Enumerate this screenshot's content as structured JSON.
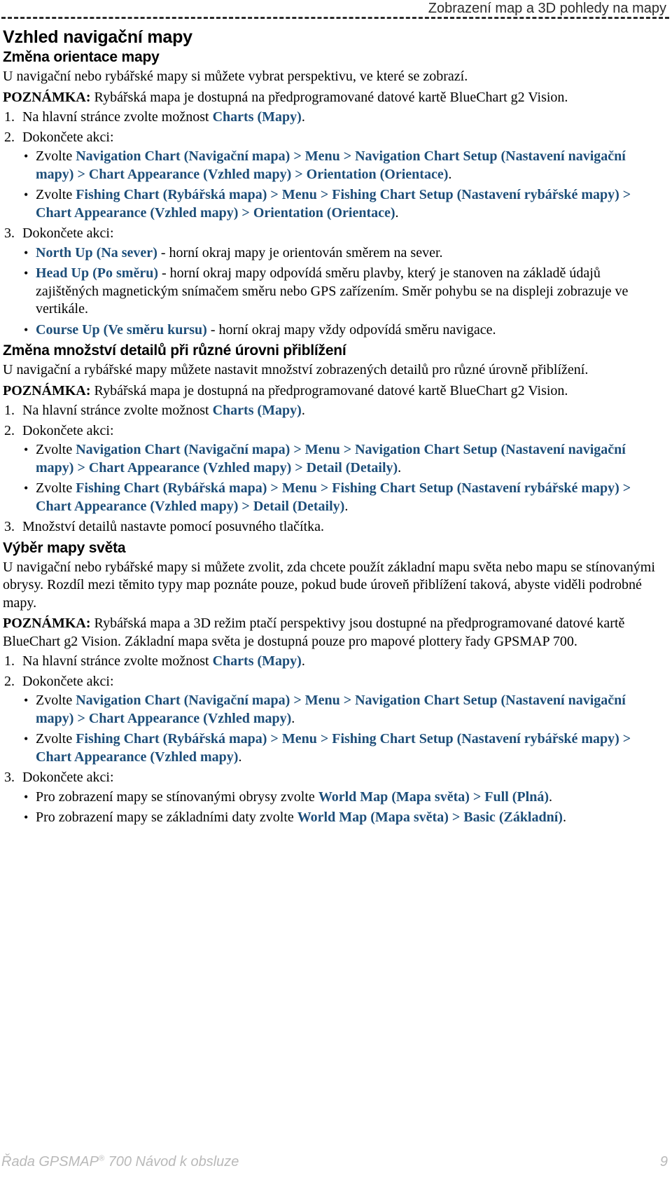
{
  "header": {
    "running_head": "Zobrazení map a 3D pohledy na mapy"
  },
  "footer": {
    "manual_title_pre": "Řada GPSMAP",
    "registered_mark": "®",
    "manual_title_post": " 700 Návod k obsluze",
    "page_number": "9"
  },
  "colors": {
    "highlight_blue": "#1d4e79",
    "body_black": "#000000",
    "header_gray": "#2b2b2b",
    "footer_gray": "#b9b9b9"
  },
  "sections": {
    "section1": {
      "title": "Vzhled navigační mapy",
      "subtitle": "Změna orientace mapy",
      "intro": "U navigační nebo rybářské mapy si můžete vybrat perspektivu, ve které se zobrazí.",
      "note_lead": "POZNÁMKA:",
      "note_text": " Rybářská mapa je dostupná na předprogramované datové kartě BlueChart g2 Vision.",
      "step1_num": "1.",
      "step1_pre": "Na hlavní stránce zvolte možnost ",
      "step1_hl": "Charts (Mapy)",
      "step1_post": ".",
      "step2_num": "2.",
      "step2_text": "Dokončete akci:",
      "bullet1_pre": "Zvolte ",
      "bullet1_hl": "Navigation Chart (Navigační mapa) > Menu > Navigation Chart Setup (Nastavení navigační mapy) > Chart Appearance (Vzhled mapy) > Orientation (Orientace)",
      "bullet1_post": ".",
      "bullet2_pre": "Zvolte ",
      "bullet2_hl": "Fishing Chart (Rybářská mapa) > Menu > Fishing Chart Setup (Nastavení rybářské mapy) > Chart Appearance (Vzhled mapy) > Orientation (Orientace)",
      "bullet2_post": ".",
      "step3_num": "3.",
      "step3_text": "Dokončete akci:",
      "opt1_hl": "North Up (Na sever)",
      "opt1_text": " - horní okraj mapy je orientován směrem na sever.",
      "opt2_hl": "Head Up (Po směru)",
      "opt2_text": " - horní okraj mapy odpovídá směru plavby, který je stanoven na základě údajů zajištěných magnetickým snímačem směru nebo GPS zařízením. Směr pohybu se na displeji zobrazuje ve vertikále.",
      "opt3_hl": "Course Up (Ve směru kursu)",
      "opt3_text": " - horní okraj mapy vždy odpovídá směru navigace."
    },
    "section2": {
      "subtitle": "Změna množství detailů při různé úrovni přiblížení",
      "intro": "U navigační a rybářské mapy můžete nastavit množství zobrazených detailů pro různé úrovně přiblížení.",
      "note_lead": "POZNÁMKA:",
      "note_text": " Rybářská mapa je dostupná na předprogramované datové kartě BlueChart g2 Vision.",
      "step1_num": "1.",
      "step1_pre": "Na hlavní stránce zvolte možnost ",
      "step1_hl": "Charts (Mapy)",
      "step1_post": ".",
      "step2_num": "2.",
      "step2_text": "Dokončete akci:",
      "bullet1_pre": "Zvolte ",
      "bullet1_hl": "Navigation Chart (Navigační mapa) > Menu > Navigation Chart Setup (Nastavení navigační mapy) > Chart Appearance (Vzhled mapy) > Detail (Detaily)",
      "bullet1_post": ".",
      "bullet2_pre": "Zvolte ",
      "bullet2_hl": "Fishing Chart (Rybářská mapa) > Menu > Fishing Chart Setup (Nastavení rybářské mapy) > Chart Appearance (Vzhled mapy) > Detail (Detaily)",
      "bullet2_post": ".",
      "step3_num": "3.",
      "step3_text": "Množství detailů nastavte pomocí posuvného tlačítka."
    },
    "section3": {
      "subtitle": "Výběr mapy světa",
      "intro": "U navigační nebo rybářské mapy si můžete zvolit, zda chcete použít základní mapu světa nebo mapu se stínovanými obrysy. Rozdíl mezi těmito typy map poznáte pouze, pokud bude úroveň přiblížení taková, abyste viděli podrobné mapy.",
      "note_lead": "POZNÁMKA:",
      "note_text": " Rybářská mapa a 3D režim ptačí perspektivy jsou dostupné na předprogramované datové kartě BlueChart g2 Vision. Základní mapa světa je dostupná pouze pro mapové plottery řady GPSMAP 700.",
      "step1_num": "1.",
      "step1_pre": "Na hlavní stránce zvolte možnost ",
      "step1_hl": "Charts (Mapy)",
      "step1_post": ".",
      "step2_num": "2.",
      "step2_text": "Dokončete akci:",
      "bullet1_pre": "Zvolte ",
      "bullet1_hl": "Navigation Chart (Navigační mapa) > Menu > Navigation Chart Setup (Nastavení navigační mapy) > Chart Appearance (Vzhled mapy)",
      "bullet1_post": ".",
      "bullet2_pre": "Zvolte ",
      "bullet2_hl": "Fishing Chart (Rybářská mapa) > Menu > Fishing Chart Setup (Nastavení rybářské mapy) > Chart Appearance (Vzhled mapy)",
      "bullet2_post": ".",
      "step3_num": "3.",
      "step3_text": "Dokončete akci:",
      "opt1_pre": "Pro zobrazení mapy se stínovanými obrysy zvolte ",
      "opt1_hl": "World Map (Mapa světa) > Full (Plná)",
      "opt1_post": ".",
      "opt2_pre": "Pro zobrazení mapy se základními daty zvolte ",
      "opt2_hl": "World Map (Mapa světa) > Basic (Základní)",
      "opt2_post": "."
    }
  },
  "glyphs": {
    "bullet_dot": "•"
  }
}
